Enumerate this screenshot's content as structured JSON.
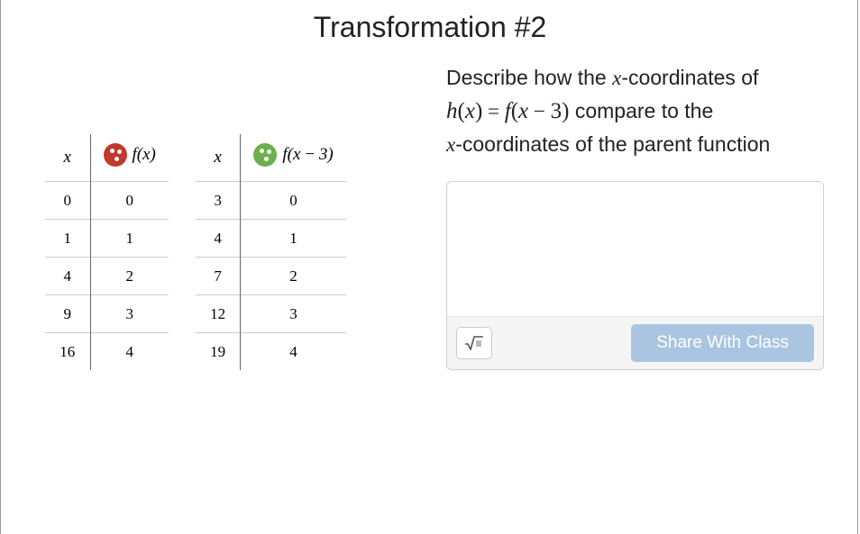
{
  "title": "Transformation #2",
  "tables": {
    "left": {
      "x_header": "x",
      "y_header": "f(x)",
      "rows": [
        {
          "x": "0",
          "y": "0"
        },
        {
          "x": "1",
          "y": "1"
        },
        {
          "x": "4",
          "y": "2"
        },
        {
          "x": "9",
          "y": "3"
        },
        {
          "x": "16",
          "y": "4"
        }
      ]
    },
    "right": {
      "x_header": "x",
      "y_header": "f(x − 3)",
      "rows": [
        {
          "x": "3",
          "y": "0"
        },
        {
          "x": "4",
          "y": "1"
        },
        {
          "x": "7",
          "y": "2"
        },
        {
          "x": "12",
          "y": "3"
        },
        {
          "x": "19",
          "y": "4"
        }
      ]
    }
  },
  "prompt": {
    "line1_pre": "Describe how the ",
    "var_x": "x",
    "coords_of": "-coordinates of ",
    "eq_h": "h",
    "eq_lp1": "(",
    "eq_x1": "x",
    "eq_rp1": ")",
    "eq_eq": " = ",
    "eq_f": "f",
    "eq_lp2": "(",
    "eq_x2": "x",
    "eq_minus": " − ",
    "eq_3": "3",
    "eq_rp2": ")",
    "compare": "  compare to the ",
    "line3_post": "-coordinates of the parent function"
  },
  "answer": {
    "placeholder": "",
    "share_label": "Share With Class"
  }
}
